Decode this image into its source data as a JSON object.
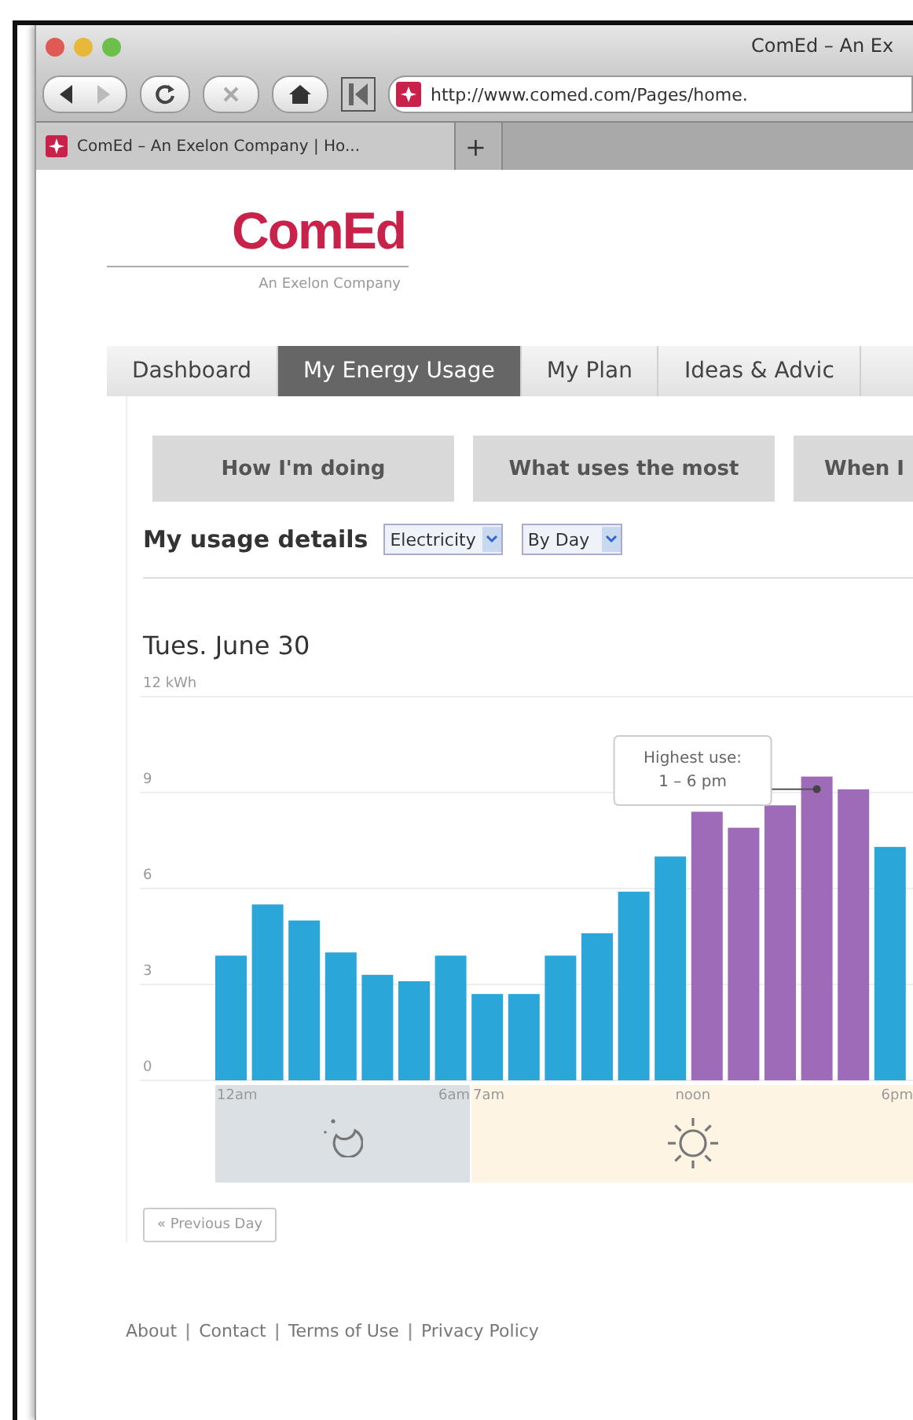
{
  "window": {
    "title": "ComEd – An Ex"
  },
  "toolbar": {
    "url": "http://www.comed.com/Pages/home."
  },
  "browser_tabs": [
    {
      "label": "ComEd – An Exelon Company | Ho...",
      "selected": true
    },
    {
      "label": "+",
      "selected": false
    }
  ],
  "logo": {
    "name": "ComEd",
    "tagline": "An Exelon Company"
  },
  "nav_tabs": [
    {
      "label": "Dashboard",
      "selected": false
    },
    {
      "label": "My Energy Usage",
      "selected": true
    },
    {
      "label": "My Plan",
      "selected": false
    },
    {
      "label": "Ideas & Advic",
      "selected": false
    }
  ],
  "sub_tabs": [
    {
      "label": "How I'm doing",
      "selected": false
    },
    {
      "label": "What uses the most",
      "selected": false
    },
    {
      "label": "When I",
      "selected": false
    }
  ],
  "usage": {
    "heading": "My usage details",
    "fuel": "Electricity",
    "period": "By Day",
    "date": "Tues. June 30",
    "chart_data": {
      "type": "bar",
      "stacked": true,
      "grid": true,
      "series": [
        {
          "color": "#2aa6d8",
          "values": [
            3.9,
            5.5,
            5.0,
            4.0,
            3.3,
            3.1,
            3.9,
            2.7,
            2.7,
            3.9,
            4.6,
            5.9,
            7.0,
            null,
            null,
            null,
            null,
            null,
            7.3
          ]
        },
        {
          "color": "#9e6bb8",
          "values": [
            null,
            null,
            null,
            null,
            null,
            null,
            null,
            null,
            null,
            null,
            null,
            null,
            null,
            8.4,
            7.9,
            8.6,
            9.5,
            9.1,
            null
          ]
        }
      ],
      "ylim": [
        0,
        12
      ],
      "yticks": [
        0,
        3,
        6,
        9,
        {
          "value": 12,
          "label": "12 kWh"
        }
      ],
      "annotations": [
        "Highest use:\n1 – 6 pm"
      ]
    },
    "periods": [
      {
        "kind": "night",
        "labels": [
          "12am",
          "6am"
        ]
      },
      {
        "kind": "day",
        "labels": [
          "7am",
          "noon",
          "6pm"
        ]
      }
    ],
    "previous_button": "« Previous Day"
  },
  "footer": [
    {
      "kind": "link",
      "text": "About"
    },
    {
      "kind": "separator",
      "text": "|"
    },
    {
      "kind": "link",
      "text": "Contact"
    },
    {
      "kind": "separator",
      "text": "|"
    },
    {
      "kind": "link",
      "text": "Terms of Use"
    },
    {
      "kind": "separator",
      "text": "|"
    },
    {
      "kind": "link",
      "text": "Privacy Policy"
    }
  ]
}
